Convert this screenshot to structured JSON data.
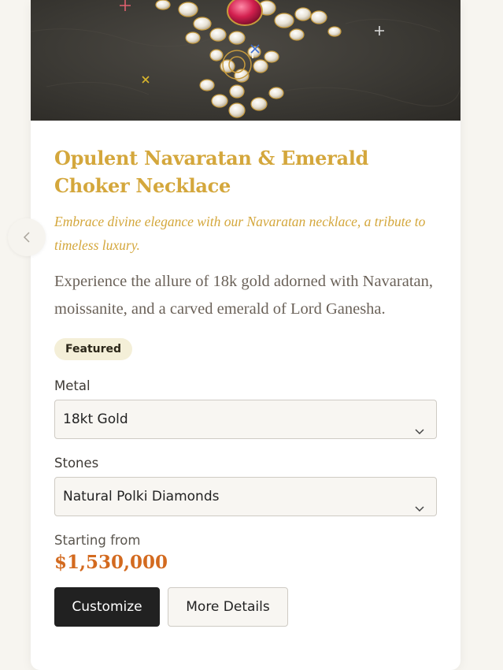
{
  "product": {
    "title": "Opulent Navaratan & Emerald Choker Necklace",
    "tagline": "Embrace divine elegance with our Navaratan necklace, a tribute to timeless luxury.",
    "description": "Experience the allure of 18k gold adorned with Navaratan, moissanite, and a carved emerald of Lord Ganesha.",
    "badge": "Featured"
  },
  "options": {
    "metal_label": "Metal",
    "metal_value": "18kt Gold",
    "stones_label": "Stones",
    "stones_value": "Natural Polki Diamonds"
  },
  "pricing": {
    "starting_label": "Starting from",
    "price": "$1,530,000"
  },
  "actions": {
    "customize": "Customize",
    "more_details": "More Details"
  },
  "icons": {
    "prev": "chevron-left-icon",
    "dropdown": "chevron-down-icon"
  },
  "colors": {
    "title_gold": "#d4a73c",
    "price_orange": "#d36a1f",
    "primary_button": "#212121"
  }
}
